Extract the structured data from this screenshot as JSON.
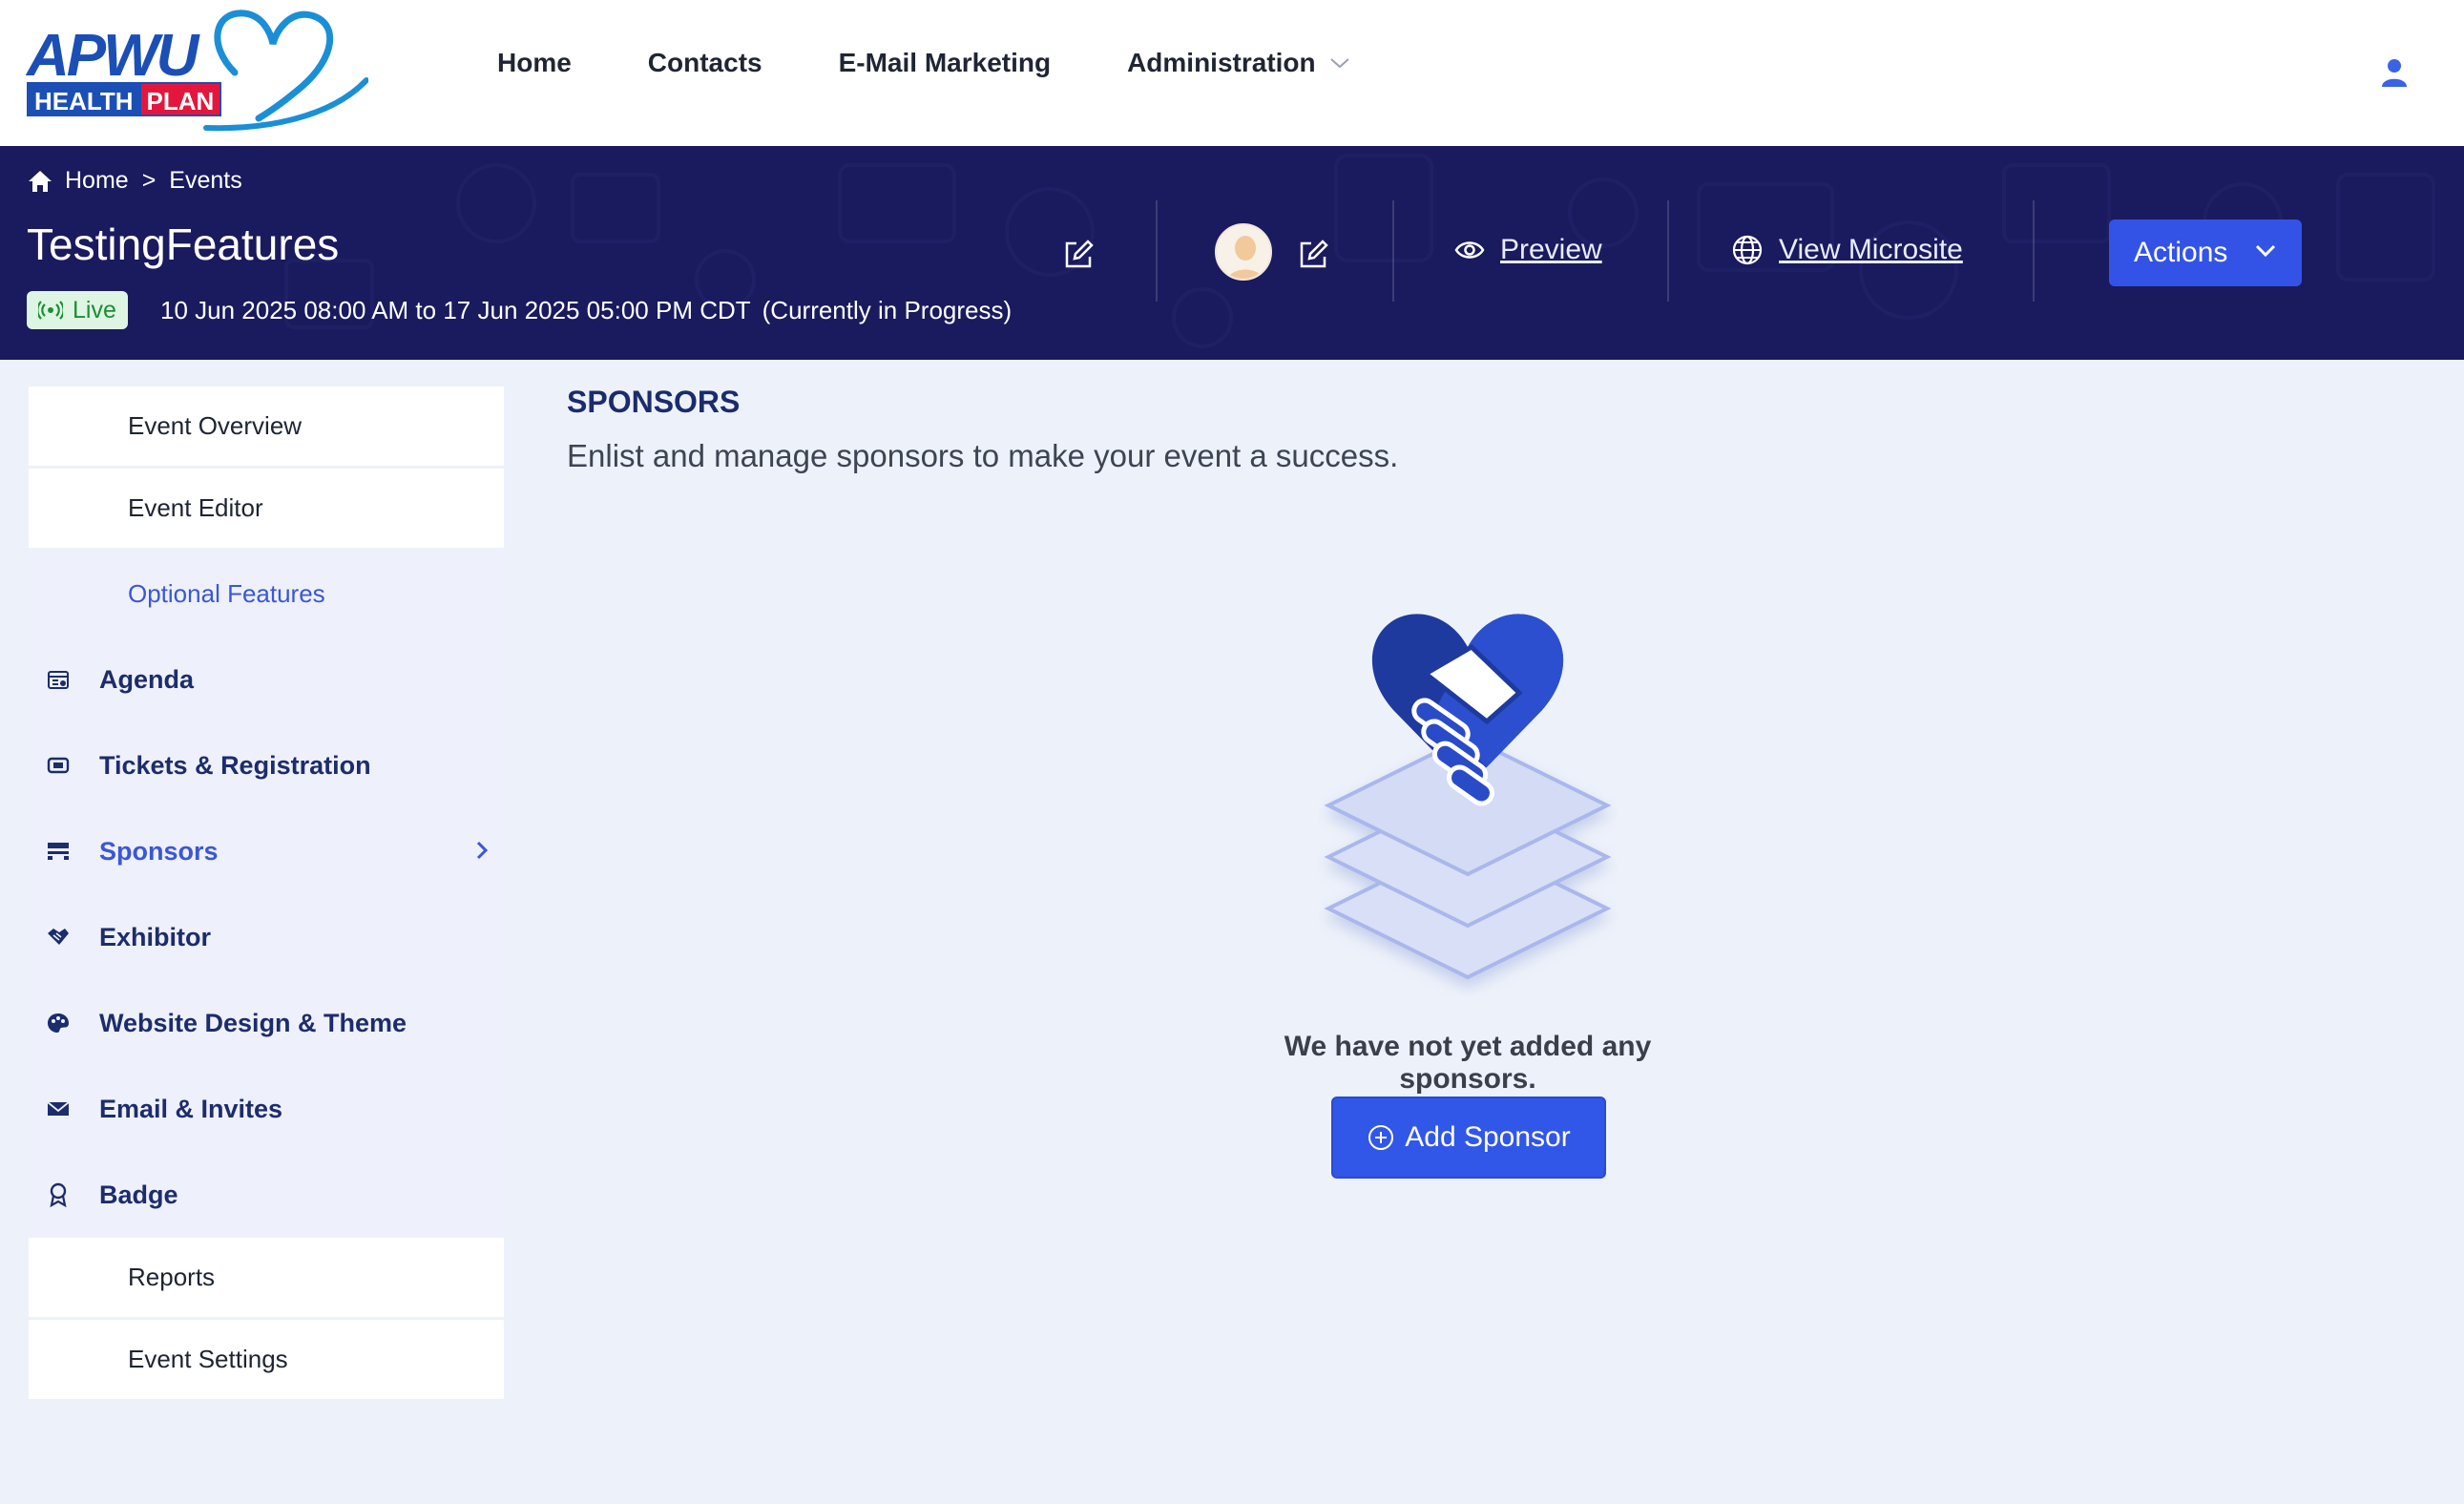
{
  "brand": {
    "logo_word": "APWU",
    "logo_health": "HEALTH",
    "logo_plan": "PLAN"
  },
  "topnav": {
    "items": [
      {
        "label": "Home"
      },
      {
        "label": "Contacts"
      },
      {
        "label": "E-Mail Marketing"
      },
      {
        "label": "Administration"
      }
    ]
  },
  "hero": {
    "breadcrumb": {
      "home": "Home",
      "separator": ">",
      "current": "Events"
    },
    "title": "TestingFeatures",
    "live_label": "Live",
    "dates": "10 Jun 2025 08:00 AM to 17 Jun 2025 05:00 PM CDT",
    "status": "(Currently in Progress)",
    "preview_label": "Preview",
    "microsite_label": "View Microsite",
    "actions_label": "Actions"
  },
  "sidebar": {
    "top": [
      {
        "label": "Event Overview"
      },
      {
        "label": "Event Editor"
      }
    ],
    "section_label": "Optional Features",
    "items": [
      {
        "label": "Agenda"
      },
      {
        "label": "Tickets & Registration"
      },
      {
        "label": "Sponsors"
      },
      {
        "label": "Exhibitor"
      },
      {
        "label": "Website Design & Theme"
      },
      {
        "label": "Email & Invites"
      },
      {
        "label": "Badge"
      }
    ],
    "bottom": [
      {
        "label": "Reports"
      },
      {
        "label": "Event Settings"
      }
    ]
  },
  "main": {
    "section_title": "SPONSORS",
    "subtitle": "Enlist and manage sponsors to make your event a success.",
    "empty_message": "We have not yet added any sponsors.",
    "add_button_label": "Add Sponsor"
  },
  "colors": {
    "accent": "#3353e7",
    "hero_bg": "#1a1a5e",
    "live_green": "#1a8f35",
    "page_bg": "#edf1fa"
  }
}
